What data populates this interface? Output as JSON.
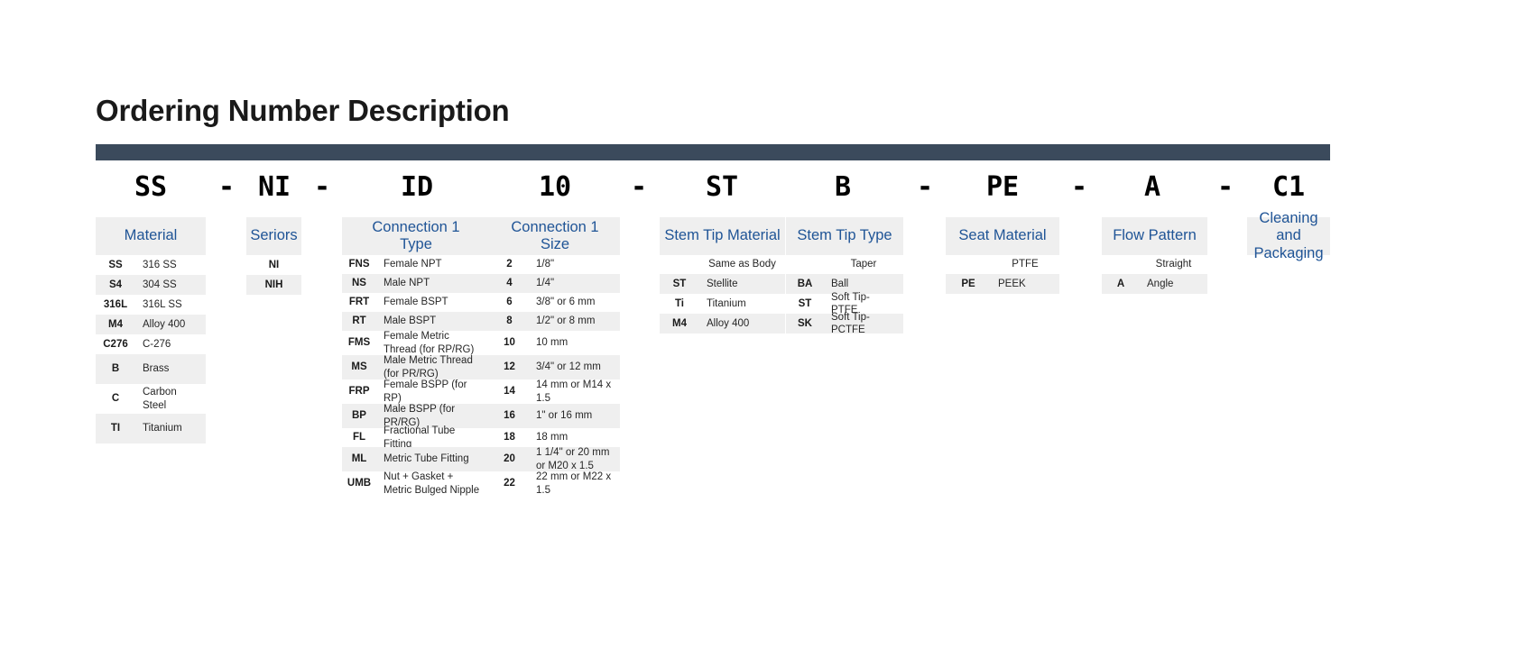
{
  "page": {
    "title": "Ordering Number Description",
    "accent_bar_color": "#3b4a5c",
    "header_text_color": "#1f5496",
    "header_bg_color": "#efefef",
    "row_shade_color": "#efefef"
  },
  "order_code": {
    "tokens": [
      "SS",
      "NI",
      "ID",
      "10",
      "ST",
      "B",
      "PE",
      "A",
      "C1"
    ],
    "separator": "-"
  },
  "columns": [
    {
      "key": "material",
      "header": "Material",
      "rows": [
        {
          "code": "SS",
          "desc": "316 SS"
        },
        {
          "code": "S4",
          "desc": "304 SS"
        },
        {
          "code": "316L",
          "desc": "316L SS"
        },
        {
          "code": "M4",
          "desc": "Alloy 400"
        },
        {
          "code": "C276",
          "desc": "C-276"
        },
        {
          "code": "B",
          "desc": "Brass"
        },
        {
          "code": "C",
          "desc": "Carbon Steel"
        },
        {
          "code": "TI",
          "desc": "Titanium"
        }
      ]
    },
    {
      "key": "seriors",
      "header": "Seriors",
      "rows": [
        {
          "code": "NI",
          "desc": ""
        },
        {
          "code": "NIH",
          "desc": ""
        }
      ]
    },
    {
      "key": "connection1type",
      "header": "Connection 1\nType",
      "header_line1": "Connection 1",
      "header_line2": "Type",
      "rows": [
        {
          "code": "FNS",
          "desc": "Female NPT"
        },
        {
          "code": "NS",
          "desc": "Male NPT"
        },
        {
          "code": "FRT",
          "desc": "Female BSPT"
        },
        {
          "code": "RT",
          "desc": "Male BSPT"
        },
        {
          "code": "FMS",
          "desc": "Female Metric Thread (for RP/RG)"
        },
        {
          "code": "MS",
          "desc": "Male Metric Thread (for PR/RG)"
        },
        {
          "code": "FRP",
          "desc": "Female BSPP (for RP)"
        },
        {
          "code": "BP",
          "desc": "Male BSPP (for PR/RG)"
        },
        {
          "code": "FL",
          "desc": "Fractional Tube Fitting"
        },
        {
          "code": "ML",
          "desc": "Metric Tube Fitting"
        },
        {
          "code": "UMB",
          "desc": "Nut + Gasket + Metric Bulged Nipple"
        }
      ]
    },
    {
      "key": "connection1size",
      "header": "Connection 1\nSize",
      "header_line1": "Connection 1",
      "header_line2": "Size",
      "rows": [
        {
          "code": "2",
          "desc": "1/8\""
        },
        {
          "code": "4",
          "desc": "1/4\""
        },
        {
          "code": "6",
          "desc": "3/8\" or 6 mm"
        },
        {
          "code": "8",
          "desc": "1/2\" or 8 mm"
        },
        {
          "code": "10",
          "desc": "10 mm"
        },
        {
          "code": "12",
          "desc": "3/4\" or 12 mm"
        },
        {
          "code": "14",
          "desc": "14 mm or M14 x 1.5"
        },
        {
          "code": "16",
          "desc": "1\" or 16 mm"
        },
        {
          "code": "18",
          "desc": "18 mm"
        },
        {
          "code": "20",
          "desc": "1 1/4\" or 20 mm or M20 x 1.5"
        },
        {
          "code": "22",
          "desc": "22 mm or M22 x 1.5"
        }
      ]
    },
    {
      "key": "stemtipmaterial",
      "header": "Stem Tip Material",
      "rows": [
        {
          "code": "",
          "desc": "Same as Body"
        },
        {
          "code": "ST",
          "desc": "Stellite"
        },
        {
          "code": "Ti",
          "desc": "Titanium"
        },
        {
          "code": "M4",
          "desc": "Alloy 400"
        }
      ]
    },
    {
      "key": "stemtiptype",
      "header": "Stem Tip Type",
      "rows": [
        {
          "code": "",
          "desc": "Taper"
        },
        {
          "code": "BA",
          "desc": "Ball"
        },
        {
          "code": "ST",
          "desc": "Soft Tip-PTFE"
        },
        {
          "code": "SK",
          "desc": "Soft Tip-PCTFE"
        }
      ]
    },
    {
      "key": "seatmaterial",
      "header": "Seat Material",
      "rows": [
        {
          "code": "",
          "desc": "PTFE"
        },
        {
          "code": "PE",
          "desc": "PEEK"
        }
      ]
    },
    {
      "key": "flowpattern",
      "header": "Flow Pattern",
      "rows": [
        {
          "code": "",
          "desc": "Straight"
        },
        {
          "code": "A",
          "desc": "Angle"
        }
      ]
    },
    {
      "key": "cleaningandpackaging",
      "header": "Cleaning and\nPackaging",
      "header_line1": "Cleaning and",
      "header_line2": "Packaging",
      "rows": []
    }
  ]
}
